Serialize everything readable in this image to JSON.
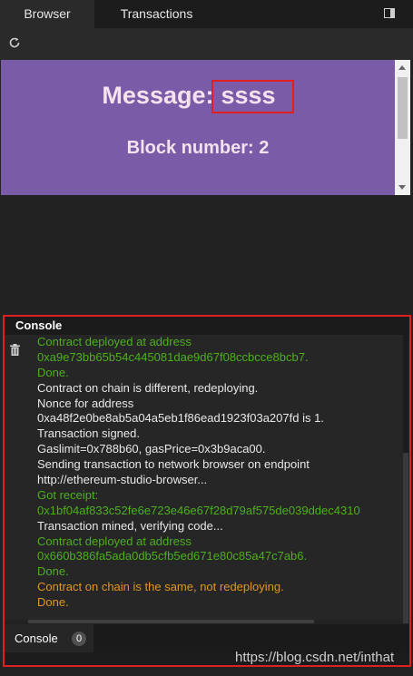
{
  "tabs": [
    {
      "label": "Browser",
      "active": true
    },
    {
      "label": "Transactions",
      "active": false
    }
  ],
  "icons": {
    "panel_toggle": "split-panel-icon",
    "refresh": "refresh-icon",
    "clear": "trash-icon"
  },
  "browser": {
    "message_label": "Message:",
    "message_value": "ssss",
    "block_line": "Block number: 2",
    "background_color": "#7a5ba8"
  },
  "console": {
    "title": "Console",
    "lines": [
      {
        "text": "Contract deployed at address",
        "color": "green"
      },
      {
        "text": "0xa9e73bb65b54c445081dae9d67f08ccbcce8bcb7.",
        "color": "green"
      },
      {
        "text": "Done.",
        "color": "green"
      },
      {
        "text": "Contract on chain is different, redeploying.",
        "color": "white"
      },
      {
        "text": "Nonce for address",
        "color": "white"
      },
      {
        "text": "0xa48f2e0be8ab5a04a5eb1f86ead1923f03a207fd is 1.",
        "color": "white"
      },
      {
        "text": "Transaction signed.",
        "color": "white"
      },
      {
        "text": "Gaslimit=0x788b60, gasPrice=0x3b9aca00.",
        "color": "white"
      },
      {
        "text": "Sending transaction to network browser on endpoint",
        "color": "white"
      },
      {
        "text": "http://ethereum-studio-browser...",
        "color": "white"
      },
      {
        "text": "Got receipt:",
        "color": "green"
      },
      {
        "text": "0x1bf04af833c52fe6e723e46e67f28d79af575de039ddec4310",
        "color": "green"
      },
      {
        "text": "Transaction mined, verifying code...",
        "color": "white"
      },
      {
        "text": "Contract deployed at address",
        "color": "green"
      },
      {
        "text": "0x660b386fa5ada0db5cfb5ed671e80c85a47c7ab6.",
        "color": "green"
      },
      {
        "text": "Done.",
        "color": "green"
      },
      {
        "text": "Contract on chain is the same, not redeploying.",
        "color": "orange"
      },
      {
        "text": "Done.",
        "color": "orange"
      }
    ]
  },
  "footer": {
    "tab_label": "Console",
    "count": "0"
  },
  "watermark": "https://blog.csdn.net/inthat",
  "colors": {
    "green": "#4cb01b",
    "white": "#e8e8e8",
    "orange": "#e3951f",
    "highlight": "#e02020"
  }
}
